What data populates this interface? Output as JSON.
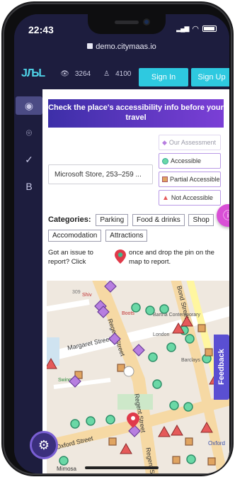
{
  "status": {
    "time": "22:43",
    "url": "demo.citymaas.io"
  },
  "header": {
    "logo": "JЉL",
    "views": "3264",
    "users": "4100",
    "sign_in": "Sign In",
    "sign_up": "Sign Up"
  },
  "nav": {
    "letter": "B"
  },
  "banner": "Check the place's accessibility info before your travel",
  "legend": {
    "our_assessment": "Our Assessment",
    "accessible": "Accessible",
    "partial": "Partial Accessible",
    "not_accessible": "Not Accessible"
  },
  "search": {
    "value": "Microsoft Store, 253–259 ..."
  },
  "categories": {
    "label": "Categories:",
    "items": [
      "Parking",
      "Food & drinks",
      "Shop",
      "Accomodation",
      "Attractions"
    ]
  },
  "report": {
    "left": "Got an issue to report? Click",
    "right": "once and drop the pin on the map to report."
  },
  "map": {
    "streets": [
      "Margaret Street",
      "Regent Street",
      "Regent Street",
      "Oxford Street",
      "Regent Street",
      "Bond Street"
    ],
    "places": [
      "Shiv",
      "Boots",
      "Bartha Contemporary",
      "London",
      "Barclays",
      "Swingers",
      "Oxford",
      "Mimosa"
    ],
    "numbers": [
      "309",
      "5"
    ]
  },
  "feedback": "Feedback",
  "colors": {
    "nav_bg": "#1d1d3e",
    "accent_cyan": "#2ec9e0",
    "banner_purple": "#6b3bcf",
    "fab_pink": "#d94fd6",
    "accessible_green": "#6ad8a6",
    "partial_orange": "#e0a461",
    "not_accessible_red": "#e55a5a",
    "assessment_purple": "#b77ee0"
  }
}
